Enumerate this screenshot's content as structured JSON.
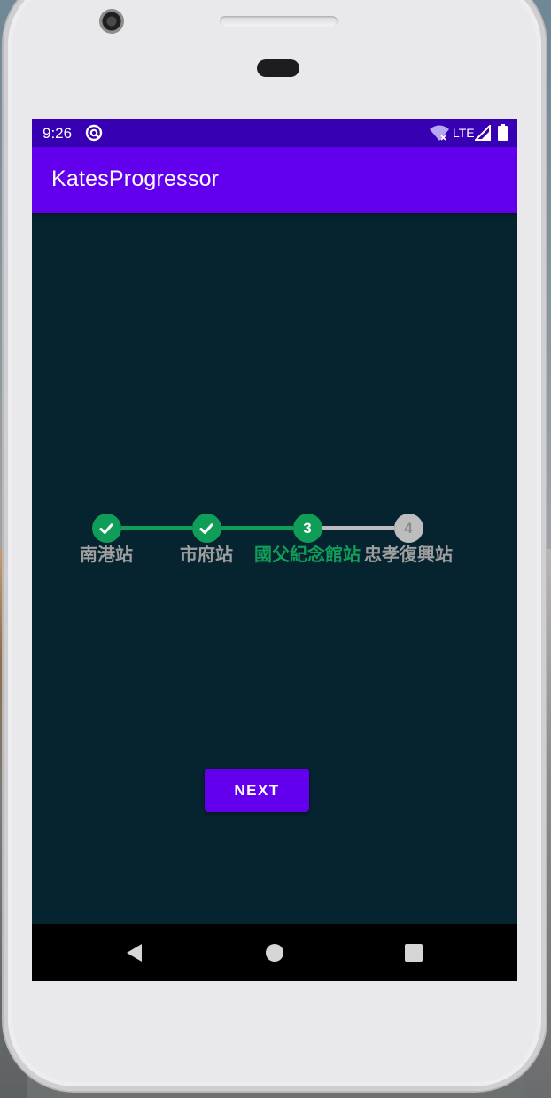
{
  "status_bar": {
    "time": "9:26",
    "network": "LTE",
    "icons": [
      "sync-icon",
      "wifi-icon",
      "signal-icon",
      "battery-icon"
    ]
  },
  "app_bar": {
    "title": "KatesProgressor"
  },
  "progressor": {
    "current_step": 3,
    "colors": {
      "done": "#0f9d58",
      "pending": "#bdbdbd",
      "label_done": "#9e9e9e",
      "label_current": "#0f9d58",
      "label_pending": "#9e9e9e"
    },
    "steps": [
      {
        "number": "1",
        "label": "南港站",
        "state": "done"
      },
      {
        "number": "2",
        "label": "市府站",
        "state": "done"
      },
      {
        "number": "3",
        "label": "國父紀念館站",
        "state": "current"
      },
      {
        "number": "4",
        "label": "忠孝復興站",
        "state": "pending"
      }
    ]
  },
  "button": {
    "label": "NEXT",
    "color": "#6200ee"
  },
  "nav_bar": {
    "icons": [
      "back-icon",
      "home-icon",
      "recents-icon"
    ]
  },
  "theme": {
    "status_bar": "#3700b3",
    "app_bar": "#6200ee",
    "background": "#062330"
  }
}
